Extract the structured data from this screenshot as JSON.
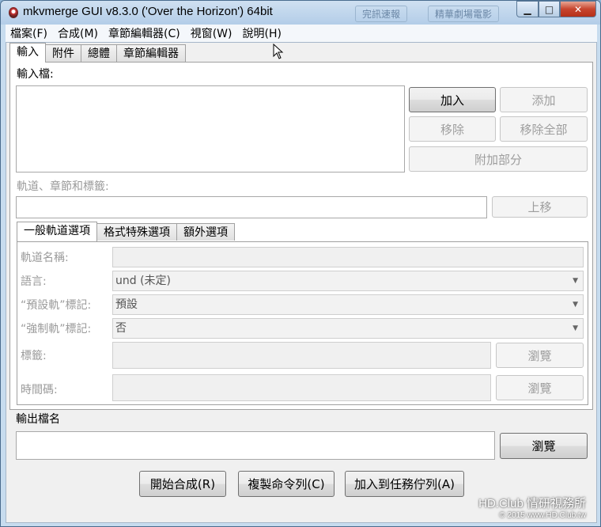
{
  "window": {
    "title": "mkvmerge GUI v8.3.0 ('Over the Horizon') 64bit",
    "background_ghost_tabs": [
      "完訊速報",
      "精華劇場電影"
    ]
  },
  "menu": [
    "檔案(F)",
    "合成(M)",
    "章節編輯器(C)",
    "視窗(W)",
    "說明(H)"
  ],
  "main_tabs": [
    "輸入",
    "附件",
    "總體",
    "章節編輯器"
  ],
  "input": {
    "files_label": "輸入檔:",
    "add_button": "加入",
    "append_button": "添加",
    "remove_button": "移除",
    "remove_all_button": "移除全部",
    "add_parts_button": "附加部分",
    "tracks_label": "軌道、章節和標籤:",
    "move_up_button": "上移"
  },
  "sub_tabs": [
    "一般軌道選項",
    "格式特殊選項",
    "額外選項"
  ],
  "track_options": {
    "track_name_label": "軌道名稱:",
    "language_label": "語言:",
    "language_value": "und (未定)",
    "default_track_label": "“預設軌”標記:",
    "default_track_value": "預設",
    "forced_track_label": "“強制軌”標記:",
    "forced_track_value": "否",
    "tags_label": "標籤:",
    "timecodes_label": "時間碼:",
    "browse_button": "瀏覽"
  },
  "output": {
    "label": "輸出檔名",
    "browse_button": "瀏覽"
  },
  "actions": {
    "start": "開始合成(R)",
    "copy_cmd": "複製命令列(C)",
    "add_job": "加入到任務佇列(A)"
  },
  "watermark": {
    "line1": "HD.Club 情研視務所",
    "line2": "© 2015 www.HD.Club.tw"
  }
}
